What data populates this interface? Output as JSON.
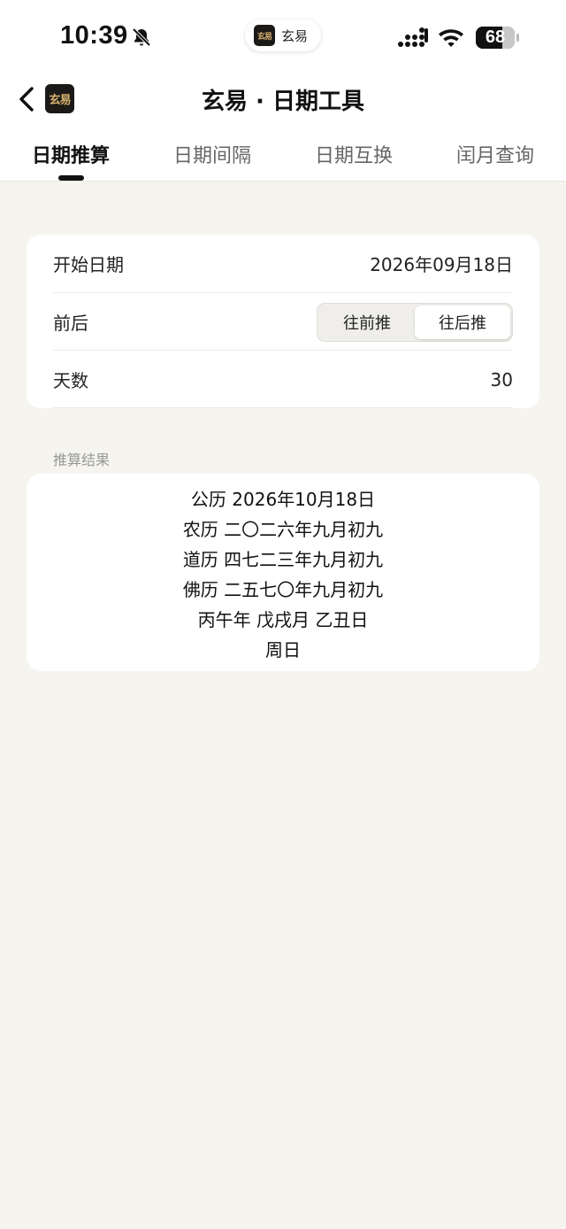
{
  "status_bar": {
    "time": "10:39",
    "battery": "68",
    "battery_level": 0.68,
    "island_app": "玄易"
  },
  "nav": {
    "logo_text": "玄易",
    "title": "玄易 · 日期工具"
  },
  "tabs": [
    {
      "label": "日期推算",
      "active": true
    },
    {
      "label": "日期间隔",
      "active": false
    },
    {
      "label": "日期互换",
      "active": false
    },
    {
      "label": "闰月查询",
      "active": false
    }
  ],
  "form": {
    "start_date_label": "开始日期",
    "start_date_value": "2026年09月18日",
    "direction_label": "前后",
    "direction_options": [
      "往前推",
      "往后推"
    ],
    "direction_selected": "往后推",
    "days_label": "天数",
    "days_value": "30"
  },
  "result": {
    "section_label": "推算结果",
    "lines": [
      "公历 2026年10月18日",
      "农历 二〇二六年九月初九",
      "道历 四七二三年九月初九",
      "佛历 二五七〇年九月初九",
      "丙午年 戊戌月 乙丑日",
      "周日"
    ]
  },
  "colors": {
    "background": "#f5f4ef",
    "card": "#ffffff",
    "logo_bg": "#1c1a17",
    "logo_text": "#d8b170"
  }
}
